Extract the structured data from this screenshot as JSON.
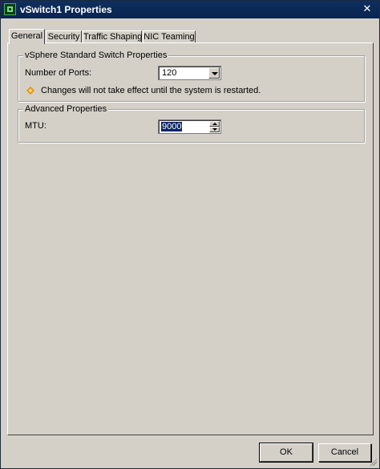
{
  "window": {
    "title": "vSwitch1 Properties"
  },
  "tabs": [
    {
      "label": "General",
      "active": true
    },
    {
      "label": "Security",
      "active": false
    },
    {
      "label": "Traffic Shaping",
      "active": false
    },
    {
      "label": "NIC Teaming",
      "active": false
    }
  ],
  "standard_group": {
    "legend": "vSphere Standard Switch Properties",
    "ports_label": "Number of Ports:",
    "ports_value": "120",
    "warning_icon": "warning-icon",
    "warning_text": "Changes will not take effect until the system is restarted."
  },
  "advanced_group": {
    "legend": "Advanced Properties",
    "mtu_label": "MTU:",
    "mtu_value": "9000"
  },
  "buttons": {
    "ok": "OK",
    "cancel": "Cancel"
  },
  "colors": {
    "titlebar": "#0e2f5e",
    "dialog": "#d4d0c8",
    "selection": "#0a246a",
    "warning": "#e08a00"
  }
}
